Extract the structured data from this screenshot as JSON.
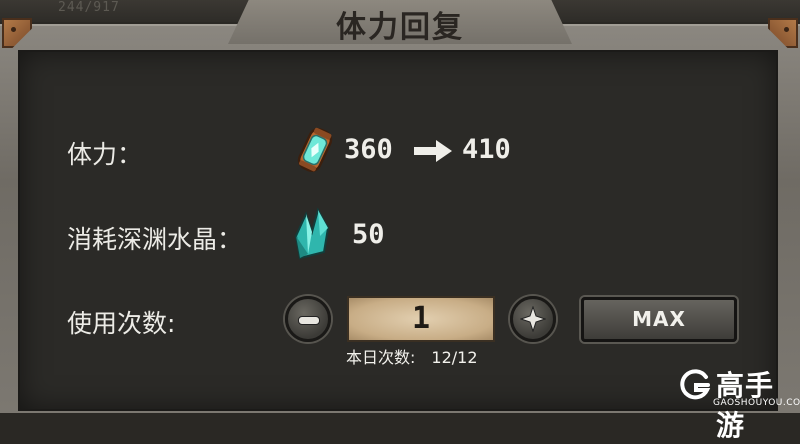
{
  "header": {
    "counter": "244/917",
    "title": "体力回复"
  },
  "stamina": {
    "label": "体力：",
    "from": "360",
    "to": "410",
    "icon": "stamina-potion-icon"
  },
  "cost": {
    "label": "消耗深渊水晶：",
    "amount": "50",
    "icon": "abyss-crystal-icon"
  },
  "usage": {
    "label": "使用次数:",
    "quantity": "1",
    "max_label": "MAX",
    "daily_label": "本日次数:",
    "daily_value": "12/12"
  },
  "watermark": {
    "name": "高手游",
    "url": "GAOSHOUYOU.COM"
  },
  "colors": {
    "panel": "#2b2a27",
    "frame": "#7c7871",
    "crystal": "#3ad6c8",
    "quantity_box": "#d6c09c"
  }
}
